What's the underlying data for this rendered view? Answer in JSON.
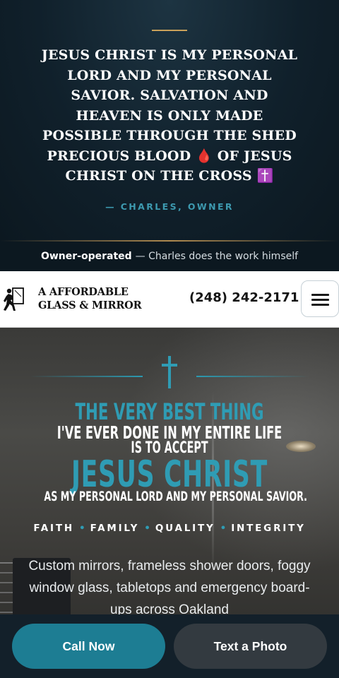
{
  "quote": {
    "lines": [
      "JESUS CHRIST IS MY PERSONAL",
      "LORD AND MY PERSONAL",
      "SAVIOR. SALVATION AND",
      "HEAVEN IS ONLY MADE",
      "POSSIBLE THROUGH THE SHED",
      "PRECIOUS BLOOD 🩸 OF JESUS",
      "CHRIST ON THE CROSS ✝️"
    ],
    "author": "— CHARLES, OWNER"
  },
  "owner_strip": {
    "strong": "Owner-operated",
    "rest": "— Charles does the work himself"
  },
  "header": {
    "logo_line1": "A AFFORDABLE",
    "logo_line2": "GLASS & MIRROR",
    "phone": "(248) 242-2171",
    "menu_icon": "hamburger-icon"
  },
  "hero": {
    "cross_icon": "cross-icon",
    "headline_1": "THE VERY BEST THING",
    "headline_2": "I'VE EVER DONE IN MY ENTIRE LIFE",
    "headline_3": "IS TO ACCEPT",
    "headline_4": "JESUS CHRIST",
    "headline_5": "AS MY PERSONAL LORD AND MY PERSONAL SAVIOR.",
    "values": [
      "FAITH",
      "FAMILY",
      "QUALITY",
      "INTEGRITY"
    ],
    "description": "Custom mirrors, frameless shower doors, foggy window glass, tabletops and emergency board-ups across Oakland"
  },
  "cta": {
    "call_label": "Call Now",
    "photo_label": "Text a Photo"
  },
  "colors": {
    "accent_teal": "#2f9cb4",
    "gold": "#c9a15a",
    "dark_navy": "#0f1b24",
    "call_button": "#1d7d93",
    "photo_button": "#333a40"
  }
}
